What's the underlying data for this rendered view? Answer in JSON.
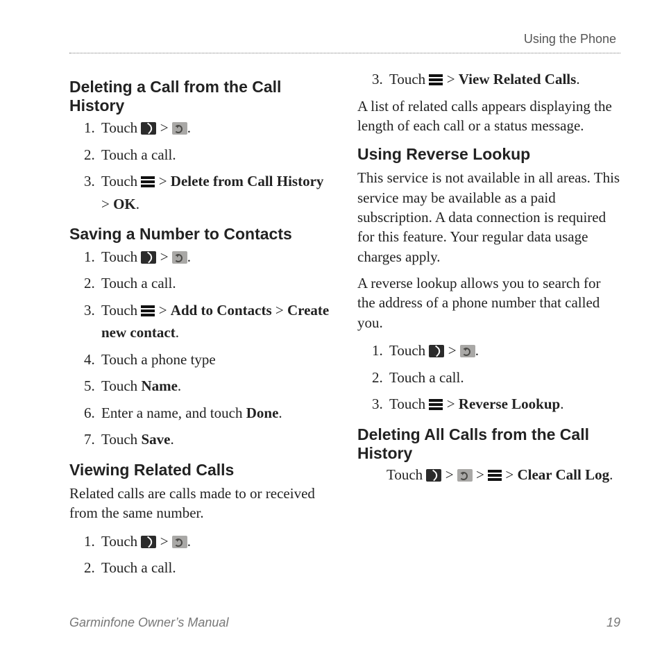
{
  "header": {
    "section": "Using the Phone"
  },
  "footer": {
    "manual": "Garminfone Owner’s Manual",
    "page": "19"
  },
  "left": {
    "sec1": {
      "title": "Deleting a Call from the Call History",
      "s1a": "Touch ",
      "s1b": " > ",
      "s1c": ".",
      "s2": "Touch a call.",
      "s3a": "Touch ",
      "s3b": " > ",
      "s3c": "Delete from Call History",
      "s3d": " > ",
      "s3e": "OK",
      "s3f": "."
    },
    "sec2": {
      "title": "Saving a Number to Contacts",
      "s1a": "Touch ",
      "s1b": " > ",
      "s1c": ".",
      "s2": "Touch a call.",
      "s3a": "Touch ",
      "s3b": " > ",
      "s3c": "Add to Contacts",
      "s3d": " > ",
      "s3e": "Create new contact",
      "s3f": ".",
      "s4": "Touch a phone type",
      "s5a": "Touch ",
      "s5b": "Name",
      "s5c": ".",
      "s6a": "Enter a name, and touch ",
      "s6b": "Done",
      "s6c": ".",
      "s7a": "Touch ",
      "s7b": "Save",
      "s7c": "."
    },
    "sec3": {
      "title": "Viewing Related Calls",
      "intro": "Related calls are calls made to or received from the same number.",
      "s1a": "Touch ",
      "s1b": " > ",
      "s1c": ".",
      "s2": "Touch a call."
    }
  },
  "right": {
    "cont": {
      "s3a": "Touch ",
      "s3b": " > ",
      "s3c": "View Related Calls",
      "s3d": ".",
      "after": "A list of related calls appears displaying the length of each call or a status message."
    },
    "sec4": {
      "title": "Using Reverse Lookup",
      "p1": "This service is not available in all areas. This service may be available as a paid subscription. A data connection is required for this feature. Your regular data usage charges apply.",
      "p2": "A reverse lookup allows you to search for the address of a phone number that called you.",
      "s1a": "Touch ",
      "s1b": " > ",
      "s1c": ".",
      "s2": "Touch a call.",
      "s3a": "Touch ",
      "s3b": " > ",
      "s3c": "Reverse Lookup",
      "s3d": "."
    },
    "sec5": {
      "title": "Deleting All Calls from the Call History",
      "sa": "Touch ",
      "sb": " > ",
      "sc": " > ",
      "sd": " > ",
      "se": "Clear Call Log",
      "sf": "."
    }
  }
}
